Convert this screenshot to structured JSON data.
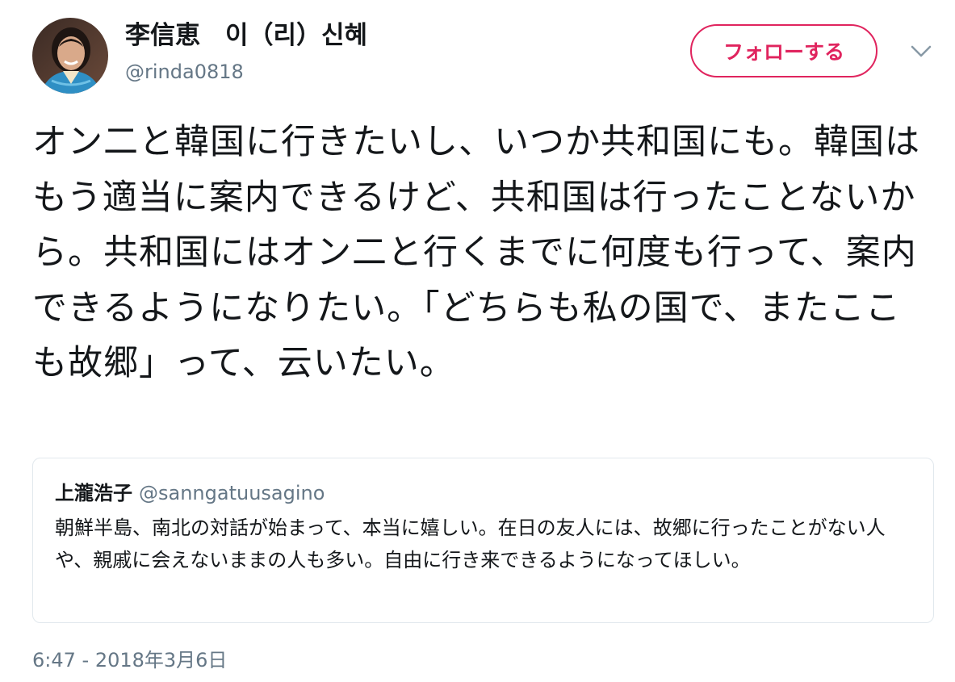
{
  "author": {
    "display_name": "李信恵　이（리）신혜",
    "handle": "@rinda0818"
  },
  "follow_button": {
    "label": "フォローする"
  },
  "tweet": {
    "text": "オン二と韓国に行きたいし、いつか共和国にも。韓国はもう適当に案内できるけど、共和国は行ったことないから。共和国にはオン二と行くまでに何度も行って、案内できるようになりたい。「どちらも私の国で、またここも故郷」って、云いたい。",
    "timestamp": "6:47 - 2018年3月6日"
  },
  "quoted_tweet": {
    "display_name": "上瀧浩子",
    "handle": "@sanngatuusagino",
    "text": "朝鮮半島、南北の対話が始まって、本当に嬉しい。在日の友人には、故郷に行ったことがない人や、親戚に会えないままの人も多い。自由に行き来できるようになってほしい。"
  },
  "icons": {
    "avatar": "profile-photo",
    "caret": "chevron-down-icon"
  },
  "colors": {
    "follow_accent": "#e0245e",
    "secondary_text": "#657786",
    "card_border": "#e1e8ed"
  }
}
